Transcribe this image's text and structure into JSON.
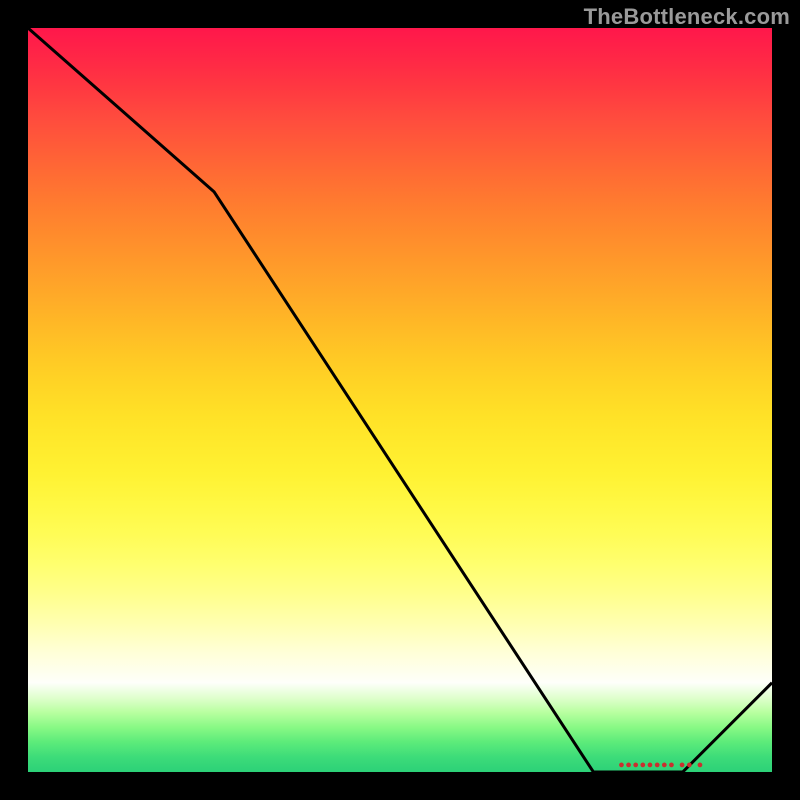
{
  "chart_data": {
    "type": "line",
    "x": [
      0.0,
      0.25,
      0.76,
      0.88,
      1.0
    ],
    "series": [
      {
        "name": "primary-curve",
        "values": [
          1.0,
          0.78,
          0.0,
          0.0,
          0.12
        ]
      }
    ],
    "title": "",
    "xlabel": "",
    "ylabel": "",
    "xlim": [
      0,
      1
    ],
    "ylim": [
      0,
      1
    ],
    "grid": false,
    "legend_position": "none"
  },
  "watermark": {
    "text": "TheBottleneck.com"
  },
  "colors": {
    "line": "#000000",
    "curve_marker": "#ca2f2f"
  }
}
